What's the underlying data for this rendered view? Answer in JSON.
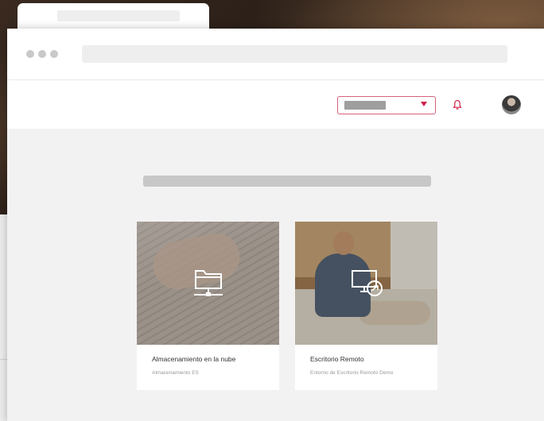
{
  "header": {
    "accent_color": "#d0204a"
  },
  "cards": [
    {
      "title": "Almacenamiento en la nube",
      "subtitle": "Almacenamiento ES",
      "icon": "network-folder-icon"
    },
    {
      "title": "Escritorio Remoto",
      "subtitle": "Entorno de Escritorio Remoto Demo",
      "icon": "remote-desktop-icon"
    }
  ]
}
